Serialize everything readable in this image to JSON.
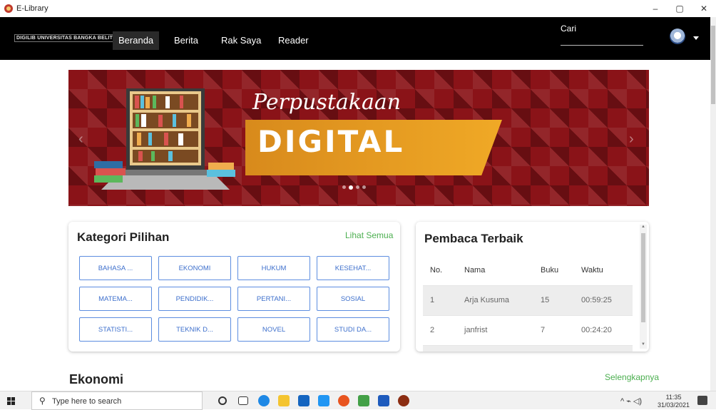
{
  "window": {
    "title": "E-Library",
    "controls": [
      "–",
      "▢",
      "✕"
    ]
  },
  "navbar": {
    "brand": "DIGILIB UNIVERSITAS BANGKA BELITUNG",
    "items": [
      {
        "label": "Beranda",
        "active": true
      },
      {
        "label": "Berita"
      },
      {
        "label": "Rak Saya"
      },
      {
        "label": "Reader"
      }
    ],
    "search_label": "Cari"
  },
  "banner": {
    "line1": "Perpustakaan",
    "line2": "DIGITAL",
    "slide_count": 4,
    "active_slide": 2
  },
  "kategori": {
    "title": "Kategori Pilihan",
    "see_all": "Lihat Semua",
    "items": [
      "BAHASA ...",
      "EKONOMI",
      "HUKUM",
      "KESEHAT...",
      "MATEMA...",
      "PENDIDIK...",
      "PERTANI...",
      "SOSIAL",
      "STATISTI...",
      "TEKNIK D...",
      "NOVEL",
      "STUDI DA..."
    ]
  },
  "pembaca": {
    "title": "Pembaca Terbaik",
    "headers": [
      "No.",
      "Nama",
      "Buku",
      "Waktu"
    ],
    "rows": [
      [
        "1",
        "Arja Kusuma",
        "15",
        "00:59:25"
      ],
      [
        "2",
        "janfrist",
        "7",
        "00:24:20"
      ]
    ]
  },
  "section": {
    "title": "Ekonomi",
    "more": "Selengkapnya"
  },
  "taskbar": {
    "search_placeholder": "Type here to search",
    "time": "11:35",
    "date": "31/03/2021"
  }
}
